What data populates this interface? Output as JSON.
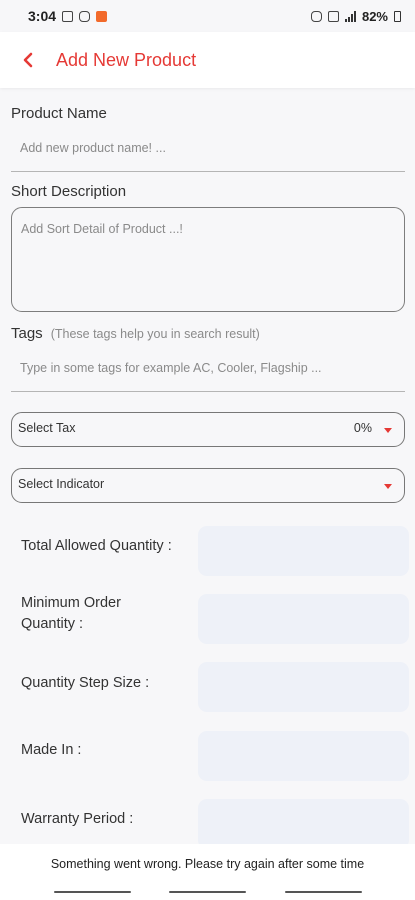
{
  "status_bar": {
    "time": "3:04",
    "battery": "82%"
  },
  "app_bar": {
    "title": "Add New Product",
    "back_icon": "chevron-left-icon"
  },
  "form": {
    "product_name": {
      "label": "Product Name",
      "placeholder": "Add new product name! ..."
    },
    "short_description": {
      "label": "Short Description",
      "placeholder": "Add Sort Detail of Product ...!"
    },
    "tags": {
      "label": "Tags",
      "hint": "(These tags help you in search result)",
      "placeholder": "Type in some tags for example AC, Cooler, Flagship ..."
    },
    "select_tax": {
      "label": "Select Tax",
      "value": "0%"
    },
    "select_indicator": {
      "label": "Select Indicator"
    },
    "quantities": [
      {
        "label": "Total Allowed Quantity :"
      },
      {
        "label": "Minimum Order Quantity :"
      },
      {
        "label": "Quantity Step Size :"
      },
      {
        "label": "Made In :"
      },
      {
        "label": "Warranty Period :"
      }
    ]
  },
  "toast": {
    "message": "Something went wrong. Please try again after some time"
  },
  "colors": {
    "accent": "#e53935",
    "field_bg": "#eef1f8"
  }
}
